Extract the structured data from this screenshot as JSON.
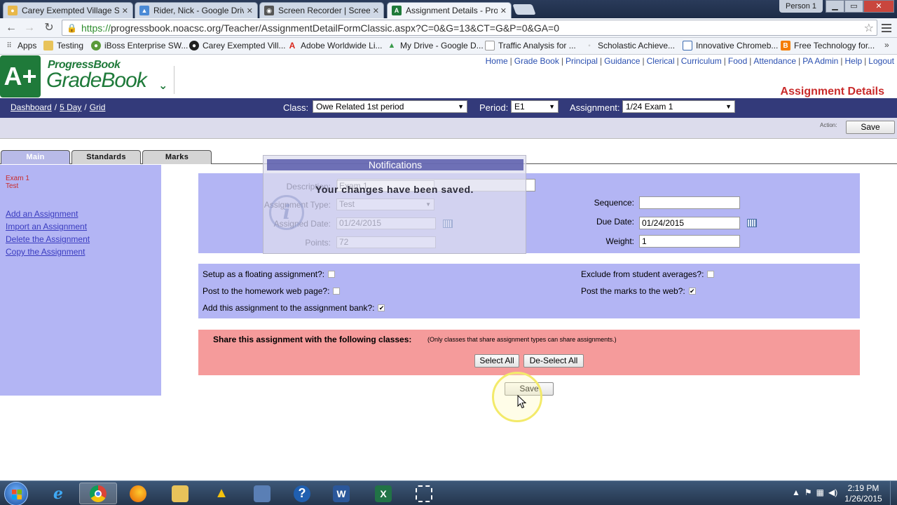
{
  "browser": {
    "tabs": [
      {
        "title": "Carey Exempted Village Sc",
        "close": "✕",
        "active": false
      },
      {
        "title": "Rider, Nick - Google Drive",
        "close": "✕",
        "active": false
      },
      {
        "title": "Screen Recorder | Screenc",
        "close": "✕",
        "active": false
      },
      {
        "title": "Assignment Details - Prog",
        "close": "✕",
        "active": true
      }
    ],
    "person": "Person 1",
    "url_scheme": "https://",
    "url_rest": "progressbook.noacsc.org/Teacher/AssignmentDetailFormClassic.aspx?C=0&G=13&CT=G&P=0&GA=0",
    "bookmarks": [
      {
        "label": "Apps",
        "icon": "apps-grid-icon"
      },
      {
        "label": "Testing",
        "icon": "folder-icon"
      },
      {
        "label": "iBoss Enterprise SW...",
        "icon": "iboss-icon"
      },
      {
        "label": "Carey Exempted Vill...",
        "icon": "carey-icon"
      },
      {
        "label": "Adobe Worldwide Li...",
        "icon": "adobe-icon"
      },
      {
        "label": "My Drive - Google D...",
        "icon": "drive-icon"
      },
      {
        "label": "Traffic Analysis for ...",
        "icon": "page-icon"
      },
      {
        "label": "Scholastic Achieve...",
        "icon": "scholastic-icon"
      },
      {
        "label": "Innovative Chromeb...",
        "icon": "doc-icon"
      },
      {
        "label": "Free Technology for...",
        "icon": "blogger-icon"
      }
    ],
    "bookmarks_more": "»"
  },
  "app": {
    "logo_letter": "A+",
    "logo_top": "ProgressBook",
    "logo_main": "GradeBook",
    "nav_links": [
      "Home",
      "Grade Book",
      "Principal",
      "Guidance",
      "Clerical",
      "Curriculum",
      "Food",
      "Attendance",
      "PA Admin",
      "Help",
      "Logout"
    ],
    "page_title": "Assignment Details",
    "breadcrumbs": [
      "Dashboard",
      "5 Day",
      "Grid"
    ],
    "class_label": "Class:",
    "class_value": "Owe Related 1st period",
    "period_label": "Period:",
    "period_value": "E1",
    "assignment_label": "Assignment:",
    "assignment_value": "1/24 Exam 1",
    "action_label": "Action:",
    "save_top": "Save",
    "tabs": [
      "Main",
      "Standards",
      "Marks"
    ]
  },
  "sidebar": {
    "assignment_name": "Exam 1",
    "assignment_type": "Test",
    "links": [
      "Add an Assignment",
      "Import an Assignment",
      "Delete the Assignment",
      "Copy the Assignment"
    ]
  },
  "form": {
    "description_label": "Description:",
    "description_value": "Exam 1",
    "type_label": "Assignment Type:",
    "type_value": "Test",
    "assigned_label": "Assigned Date:",
    "assigned_value": "01/24/2015",
    "points_label": "Points:",
    "points_value": "72",
    "sequence_label": "Sequence:",
    "sequence_value": "",
    "due_label": "Due Date:",
    "due_value": "01/24/2015",
    "weight_label": "Weight:",
    "weight_value": "1"
  },
  "options": {
    "floating": {
      "label": "Setup as a floating assignment?:",
      "checked": false
    },
    "homework": {
      "label": "Post to the homework web page?:",
      "checked": false
    },
    "bank": {
      "label": "Add this assignment to the assignment bank?:",
      "checked": true
    },
    "exclude": {
      "label": "Exclude from student averages?:",
      "checked": false
    },
    "post_marks": {
      "label": "Post the marks to the web?:",
      "checked": true
    }
  },
  "share": {
    "title": "Share this assignment with the following classes:",
    "note": "(Only classes that share assignment types can share assignments.)",
    "select_all": "Select All",
    "deselect_all": "De-Select All"
  },
  "save_bottom": "Save",
  "notification": {
    "title": "Notifications",
    "message": "Your changes have been saved.",
    "icon_glyph": "i"
  },
  "taskbar": {
    "time": "2:19 PM",
    "date": "1/26/2015"
  },
  "colors": {
    "brand_green": "#1f7a3a",
    "header_blue": "#333a7a",
    "panel_lavender": "#b3b5f4",
    "share_pink": "#f59b9b",
    "title_red": "#c92b2b"
  }
}
